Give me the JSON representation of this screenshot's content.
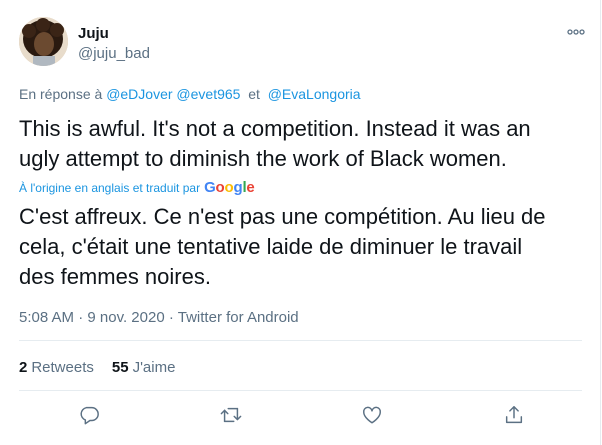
{
  "user": {
    "display_name": "Juju",
    "handle": "@juju_bad"
  },
  "reply": {
    "prefix": "En réponse à",
    "mentions": [
      "@eDJover",
      "@evet965",
      "@EvaLongoria"
    ],
    "conjunction": "et"
  },
  "tweet": {
    "text": "This is awful. It's not a competition. Instead it was an\nugly attempt to diminish the work of Black women.",
    "translated_by": "À l'origine en anglais et traduit par",
    "translation": "C'est affreux. Ce n'est pas une compétition. Au lieu de\ncela, c'était une tentative laide de diminuer le travail\ndes femmes noires.",
    "time": "5:08 AM",
    "separator": "·",
    "date": "9 nov. 2020",
    "source": "Twitter for Android"
  },
  "google_logo": {
    "letters": [
      "G",
      "o",
      "o",
      "g",
      "l",
      "e"
    ],
    "colors": [
      "#4285F4",
      "#EA4335",
      "#FBBC05",
      "#4285F4",
      "#34A853",
      "#EA4335"
    ]
  },
  "stats": {
    "retweets_count": "2",
    "retweets_label": "Retweets",
    "likes_count": "55",
    "likes_label": "J'aime"
  },
  "icons": {
    "more": "more-horizontal-icon",
    "reply": "reply-icon",
    "retweet": "retweet-icon",
    "like": "like-icon",
    "share": "share-icon"
  },
  "colors": {
    "link": "#1b95e0",
    "secondary_text": "#5b7083",
    "primary_text": "#0f1419",
    "divider": "#e6ecf0"
  }
}
